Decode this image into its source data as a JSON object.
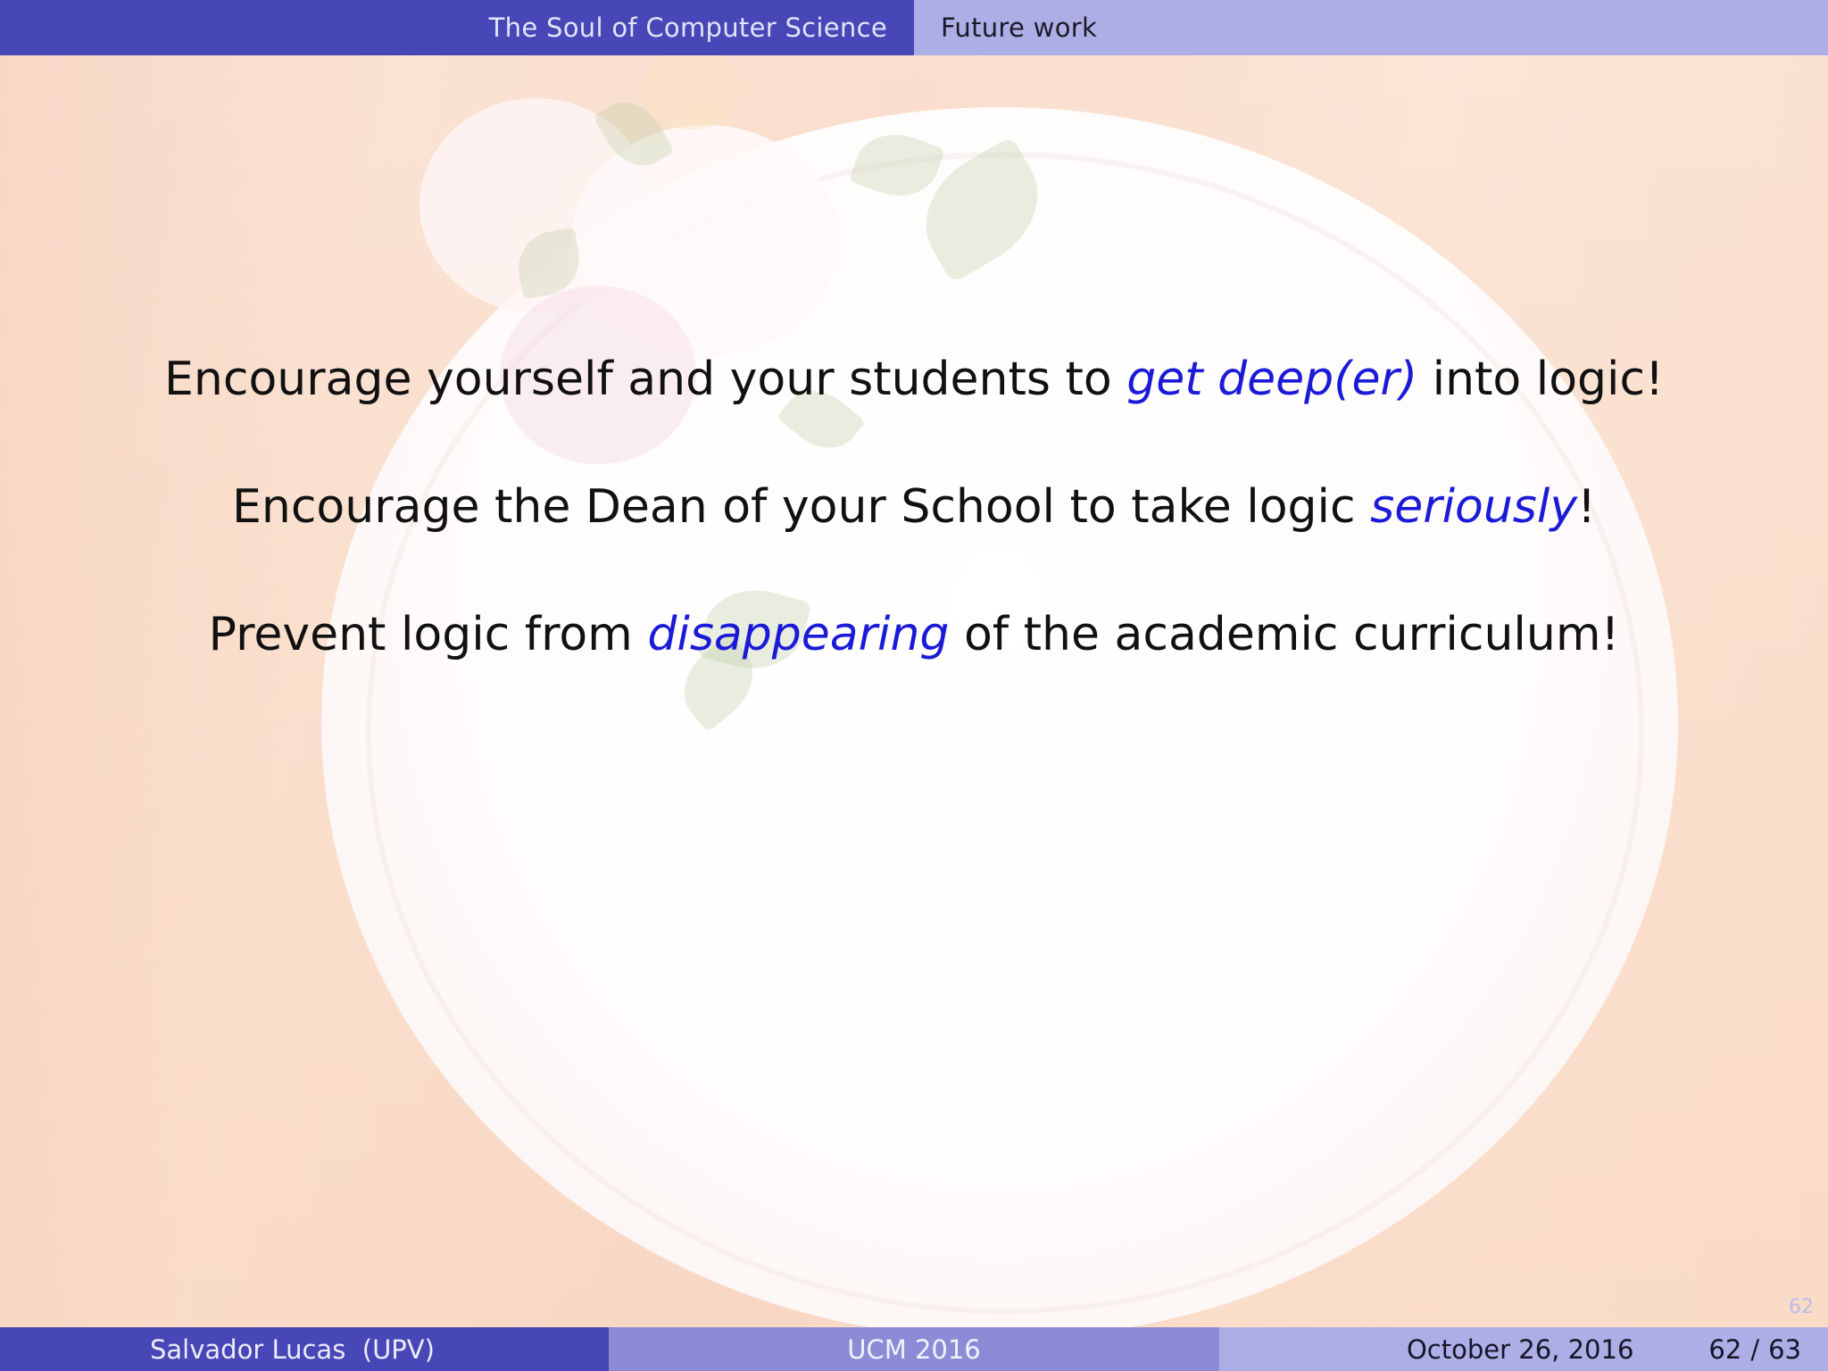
{
  "header": {
    "section": "The Soul of Computer Science",
    "subsection": "Future work"
  },
  "content": {
    "lines": [
      {
        "before": "Encourage yourself and your students to ",
        "emphasis": "get deep(er)",
        "after": " into logic!"
      },
      {
        "before": "Encourage the Dean of your School to take logic ",
        "emphasis": "seriously",
        "after": "!"
      },
      {
        "before": "Prevent logic from ",
        "emphasis": "disappearing",
        "after": " of the academic curriculum!"
      }
    ],
    "emphasis_color": "#1a1ad8"
  },
  "page_mark": "62",
  "footer": {
    "author": "Salvador Lucas  (UPV)",
    "venue": "UCM 2016",
    "date": "October 26, 2016",
    "page_current": "62",
    "page_separator": "/",
    "page_total": "63"
  },
  "colors": {
    "bar_dark": "#4747b8",
    "bar_mid": "#8b8bd6",
    "bar_light": "#adaee5"
  }
}
